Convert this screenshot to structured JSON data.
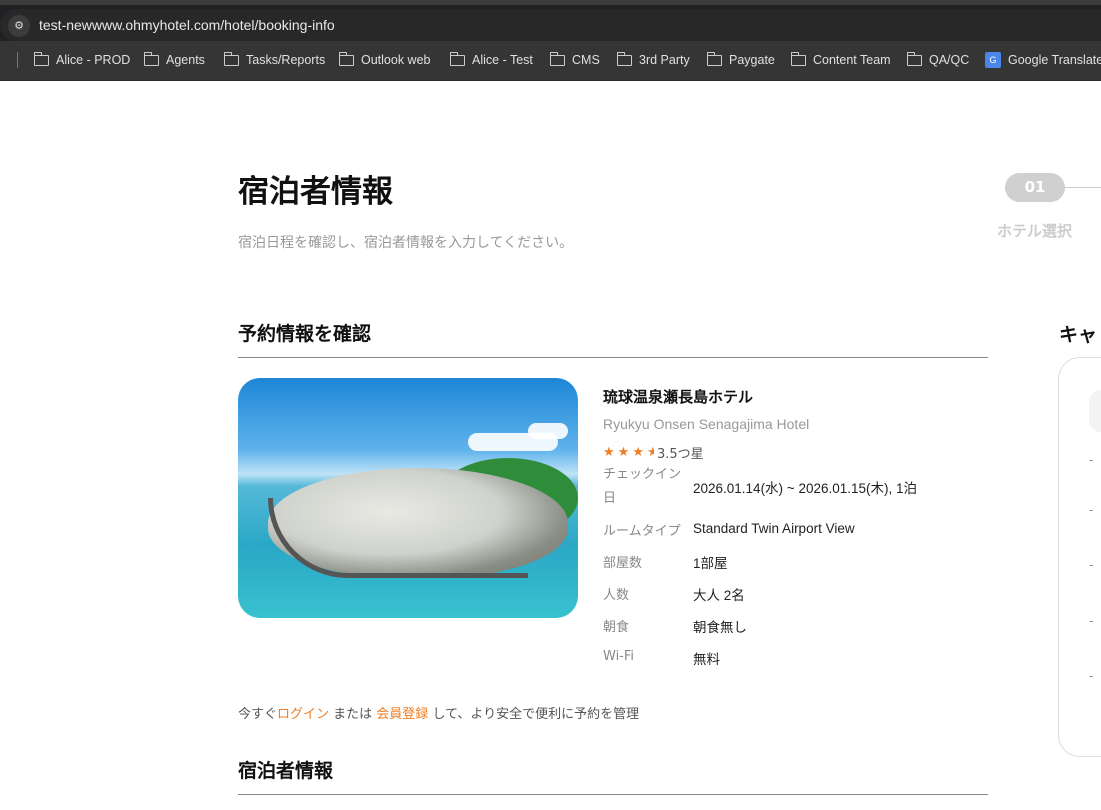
{
  "browser": {
    "url": "test-newwww.ohmyhotel.com/hotel/booking-info",
    "bookmarks": [
      "Alice - PROD",
      "Agents",
      "Tasks/Reports",
      "Outlook web",
      "Alice - Test",
      "CMS",
      "3rd Party",
      "Paygate",
      "Content Team",
      "QA/QC",
      "Google Translate"
    ]
  },
  "page": {
    "title": "宿泊者情報",
    "subtitle": "宿泊日程を確認し、宿泊者情報を入力してください。",
    "step": {
      "number": "01",
      "label": "ホテル選択"
    }
  },
  "reservation": {
    "heading": "予約情報を確認",
    "hotel_name": "琉球温泉瀬長島ホテル",
    "hotel_name_en": "Ryukyu Onsen Senagajima Hotel",
    "rating": 3.5,
    "rating_label": "3.5つ星",
    "details": [
      {
        "label": "チェックイン日",
        "value": "2026.01.14(水) ~ 2026.01.15(木), 1泊"
      },
      {
        "label": "ルームタイプ",
        "value": "Standard Twin Airport View"
      },
      {
        "label": "部屋数",
        "value": "1部屋"
      },
      {
        "label": "人数",
        "value": "大人 2名"
      },
      {
        "label": "朝食",
        "value": "朝食無し"
      },
      {
        "label": "Wi-Fi",
        "value": "無料"
      }
    ],
    "login_prompt": {
      "prefix": "今すぐ",
      "login": "ログイン",
      "or": " または ",
      "register": "会員登録",
      "suffix": " して、より安全で便利に予約を管理"
    }
  },
  "guest": {
    "heading": "宿泊者情報"
  },
  "sidebar": {
    "title": "キャ",
    "dashes": [
      "-",
      "-",
      "-",
      "-",
      "-"
    ]
  },
  "colors": {
    "accent": "#f07d22"
  }
}
